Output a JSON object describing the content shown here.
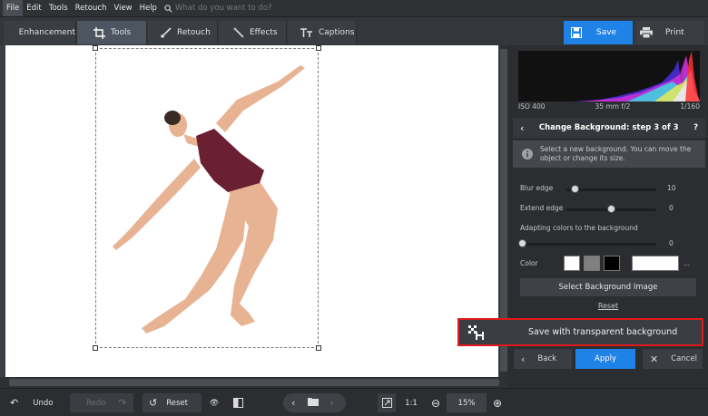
{
  "menu": {
    "items": [
      "File",
      "Edit",
      "Tools",
      "Retouch",
      "View",
      "Help"
    ],
    "search_placeholder": "What do you want to do?"
  },
  "toolbar": {
    "tabs": [
      "Enhancement",
      "Tools",
      "Retouch",
      "Effects",
      "Captions"
    ],
    "active_tab": "Tools",
    "save_label": "Save",
    "print_label": "Print",
    "accent_color": "#1f82e6"
  },
  "histogram": {
    "iso": "ISO 400",
    "lens": "35 mm f/2",
    "shutter": "1/160"
  },
  "step": {
    "title": "Change Background: step 3 of 3",
    "help": "?",
    "info_text_line1": "Select a new background. You can move the",
    "info_text_line2": "object or change its size."
  },
  "controls": {
    "blur_edge_label": "Blur edge",
    "blur_edge_value": "10",
    "blur_edge_fraction": 0.1,
    "extend_edge_label": "Extend edge",
    "extend_edge_value": "0",
    "extend_edge_fraction": 0.5,
    "adapt_label": "Adapting colors to the background",
    "adapt_value": "0",
    "adapt_fraction": 0.0,
    "color_label": "Color",
    "swatches": [
      "#ffffff",
      "#808080",
      "#000000"
    ],
    "custom_color": "#ffffff",
    "more": "...",
    "select_bg_label": "Select Background Image",
    "reset_label": "Reset"
  },
  "transparent_button": "Save with transparent background",
  "nav": {
    "back": "Back",
    "apply": "Apply",
    "cancel": "Cancel"
  },
  "bottom": {
    "undo": "Undo",
    "redo": "Redo",
    "reset": "Reset",
    "ratio": "1:1",
    "zoom": "15%"
  }
}
